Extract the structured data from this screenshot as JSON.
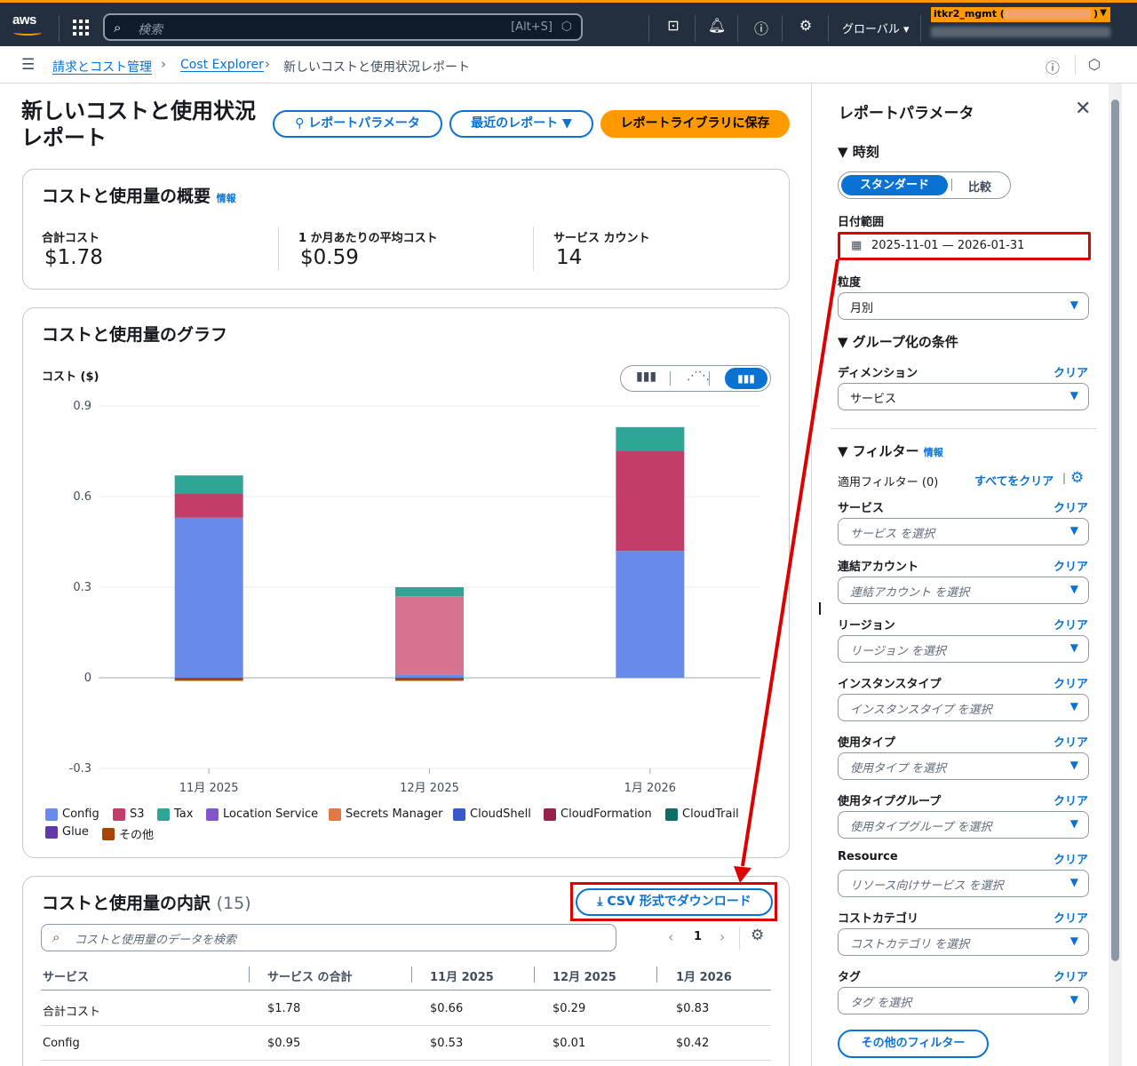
{
  "topbar": {
    "logo": "aws",
    "search_placeholder": "検索",
    "search_shortcut": "[Alt+S]",
    "region": "グローバル",
    "account_label": "itkr2_mgmt (",
    "account_close": ")",
    "icons": [
      "grid-icon",
      "search-icon",
      "cloudshell-icon",
      "bell-icon",
      "help-icon",
      "gear-icon"
    ]
  },
  "breadcrumb": {
    "items": [
      "請求とコスト管理",
      "Cost Explorer",
      "新しいコストと使用状況レポート"
    ]
  },
  "page": {
    "title_line1": "新しいコストと使用状況",
    "title_line2": "レポート",
    "btn_params": "レポートパラメータ",
    "btn_recent": "最近のレポート",
    "btn_save": "レポートライブラリに保存"
  },
  "summary": {
    "title": "コストと使用量の概要",
    "info": "情報",
    "total_label": "合計コスト",
    "total_value": "$1.78",
    "avg_label": "1 か月あたりの平均コスト",
    "avg_value": "$0.59",
    "count_label": "サービス カウント",
    "count_value": "14"
  },
  "graph": {
    "title": "コストと使用量のグラフ",
    "y_label": "コスト ($)"
  },
  "chart_data": {
    "type": "bar",
    "stacked": true,
    "categories": [
      "11月 2025",
      "12月 2025",
      "1月 2026"
    ],
    "ylim": [
      -0.3,
      0.9
    ],
    "yticks": [
      "0.9",
      "0.6",
      "0.3",
      "0",
      "-0.3"
    ],
    "ytick_values": [
      0.9,
      0.6,
      0.3,
      0,
      -0.3
    ],
    "ylabel": "コスト ($)",
    "series": [
      {
        "name": "Config",
        "color": "#688ae8",
        "values": [
          0.53,
          0.01,
          0.42
        ]
      },
      {
        "name": "S3",
        "color": "#c33d69",
        "values": [
          0.08,
          0.26,
          0.33
        ]
      },
      {
        "name": "Tax",
        "color": "#2ea597",
        "values": [
          0.06,
          0.03,
          0.08
        ]
      },
      {
        "name": "Location Service",
        "color": "#8456ce",
        "values": [
          0,
          0,
          0
        ]
      },
      {
        "name": "Secrets Manager",
        "color": "#e07941",
        "values": [
          0,
          0,
          0
        ]
      },
      {
        "name": "CloudShell",
        "color": "#3759ce",
        "values": [
          0,
          0,
          0
        ]
      },
      {
        "name": "CloudFormation",
        "color": "#962249",
        "values": [
          0,
          0,
          0
        ]
      },
      {
        "name": "CloudTrail",
        "color": "#096f64",
        "values": [
          0,
          0,
          0
        ]
      },
      {
        "name": "Glue",
        "color": "#6237a7",
        "values": [
          0,
          0,
          0
        ]
      },
      {
        "name": "その他",
        "color": "#a84401",
        "values": [
          -0.01,
          -0.01,
          0
        ]
      }
    ],
    "series_colors_month2_s3": "#d6738f",
    "legend_position": "bottom",
    "grid": true
  },
  "breakdown": {
    "title": "コストと使用量の内訳",
    "count": "(15)",
    "csv_button": "CSV 形式でダウンロード",
    "search_placeholder": "コストと使用量のデータを検索",
    "page": "1",
    "columns": [
      "サービス",
      "サービス の合計",
      "11月 2025",
      "12月 2025",
      "1月 2026"
    ],
    "rows": [
      [
        "合計コスト",
        "$1.78",
        "$0.66",
        "$0.29",
        "$0.83"
      ],
      [
        "Config",
        "$0.95",
        "$0.53",
        "$0.01",
        "$0.42"
      ]
    ]
  },
  "panel": {
    "title": "レポートパラメータ",
    "time_section": "時刻",
    "seg_standard": "スタンダード",
    "seg_compare": "比較",
    "date_label": "日付範囲",
    "date_value": "2025-11-01 — 2026-01-31",
    "gran_label": "粒度",
    "gran_value": "月別",
    "group_section": "グループ化の条件",
    "dim_label": "ディメンション",
    "dim_value": "サービス",
    "clear": "クリア",
    "filter_section": "フィルター",
    "filter_info": "情報",
    "applied": "適用フィルター (0)",
    "clear_all": "すべてをクリア",
    "filters": [
      {
        "label": "サービス",
        "placeholder": "サービス を選択"
      },
      {
        "label": "連結アカウント",
        "placeholder": "連結アカウント を選択"
      },
      {
        "label": "リージョン",
        "placeholder": "リージョン を選択"
      },
      {
        "label": "インスタンスタイプ",
        "placeholder": "インスタンスタイプ を選択"
      },
      {
        "label": "使用タイプ",
        "placeholder": "使用タイプ を選択"
      },
      {
        "label": "使用タイプグループ",
        "placeholder": "使用タイプグループ を選択"
      },
      {
        "label": "Resource",
        "placeholder": "リソース向けサービス を選択"
      },
      {
        "label": "コストカテゴリ",
        "placeholder": "コストカテゴリ を選択"
      },
      {
        "label": "タグ",
        "placeholder": "タグ を選択"
      }
    ],
    "more_filters": "その他のフィルター"
  },
  "colors": {
    "accent": "#0972d3",
    "primary_button": "#ff9900",
    "annotation": "#dd0000"
  }
}
